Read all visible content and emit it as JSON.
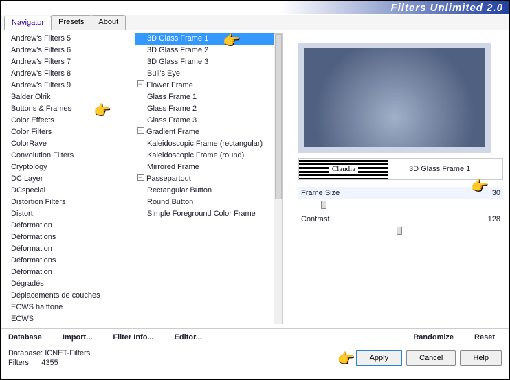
{
  "title": "Filters Unlimited 2.0",
  "tabs": [
    "Navigator",
    "Presets",
    "About"
  ],
  "categories": [
    "Andrew's Filters 5",
    "Andrew's Filters 6",
    "Andrew's Filters 7",
    "Andrew's Filters 8",
    "Andrew's Filters 9",
    "Balder Olrik",
    "Buttons & Frames",
    "Color Effects",
    "Color Filters",
    "ColorRave",
    "Convolution Filters",
    "Cryptology",
    "DC Layer",
    "DCspecial",
    "Distortion Filters",
    "Distort",
    "Déformation",
    "Déformations",
    "Déformation",
    "Déformations",
    "Déformation",
    "Dégradés",
    "Déplacements de couches",
    "ECWS halftone",
    "ECWS"
  ],
  "filters": [
    {
      "label": "3D Glass Frame 1",
      "group": false,
      "selected": true
    },
    {
      "label": "3D Glass Frame 2",
      "group": false
    },
    {
      "label": "3D Glass Frame 3",
      "group": false
    },
    {
      "label": "Bull's Eye",
      "group": false
    },
    {
      "label": "Flower Frame",
      "group": true
    },
    {
      "label": "Glass Frame 1",
      "group": false
    },
    {
      "label": "Glass Frame 2",
      "group": false
    },
    {
      "label": "Glass Frame 3",
      "group": false
    },
    {
      "label": "Gradient Frame",
      "group": true
    },
    {
      "label": "Kaleidoscopic Frame (rectangular)",
      "group": false
    },
    {
      "label": "Kaleidoscopic Frame (round)",
      "group": false
    },
    {
      "label": "Mirrored Frame",
      "group": false
    },
    {
      "label": "Passepartout",
      "group": true
    },
    {
      "label": "Rectangular Button",
      "group": false
    },
    {
      "label": "Round Button",
      "group": false
    },
    {
      "label": "Simple Foreground Color Frame",
      "group": false
    }
  ],
  "watermark": "Claudia",
  "selected_filter": "3D Glass Frame 1",
  "params": [
    {
      "name": "Frame Size",
      "value": "30"
    },
    {
      "name": "Contrast",
      "value": "128"
    }
  ],
  "buttons": {
    "database": "Database",
    "import": "Import...",
    "filterinfo": "Filter Info...",
    "editor": "Editor...",
    "randomize": "Randomize",
    "reset": "Reset"
  },
  "status": {
    "db_label": "Database:",
    "db_val": "ICNET-Filters",
    "filters_label": "Filters:",
    "filters_val": "4355"
  },
  "actions": {
    "apply": "Apply",
    "cancel": "Cancel",
    "help": "Help"
  }
}
